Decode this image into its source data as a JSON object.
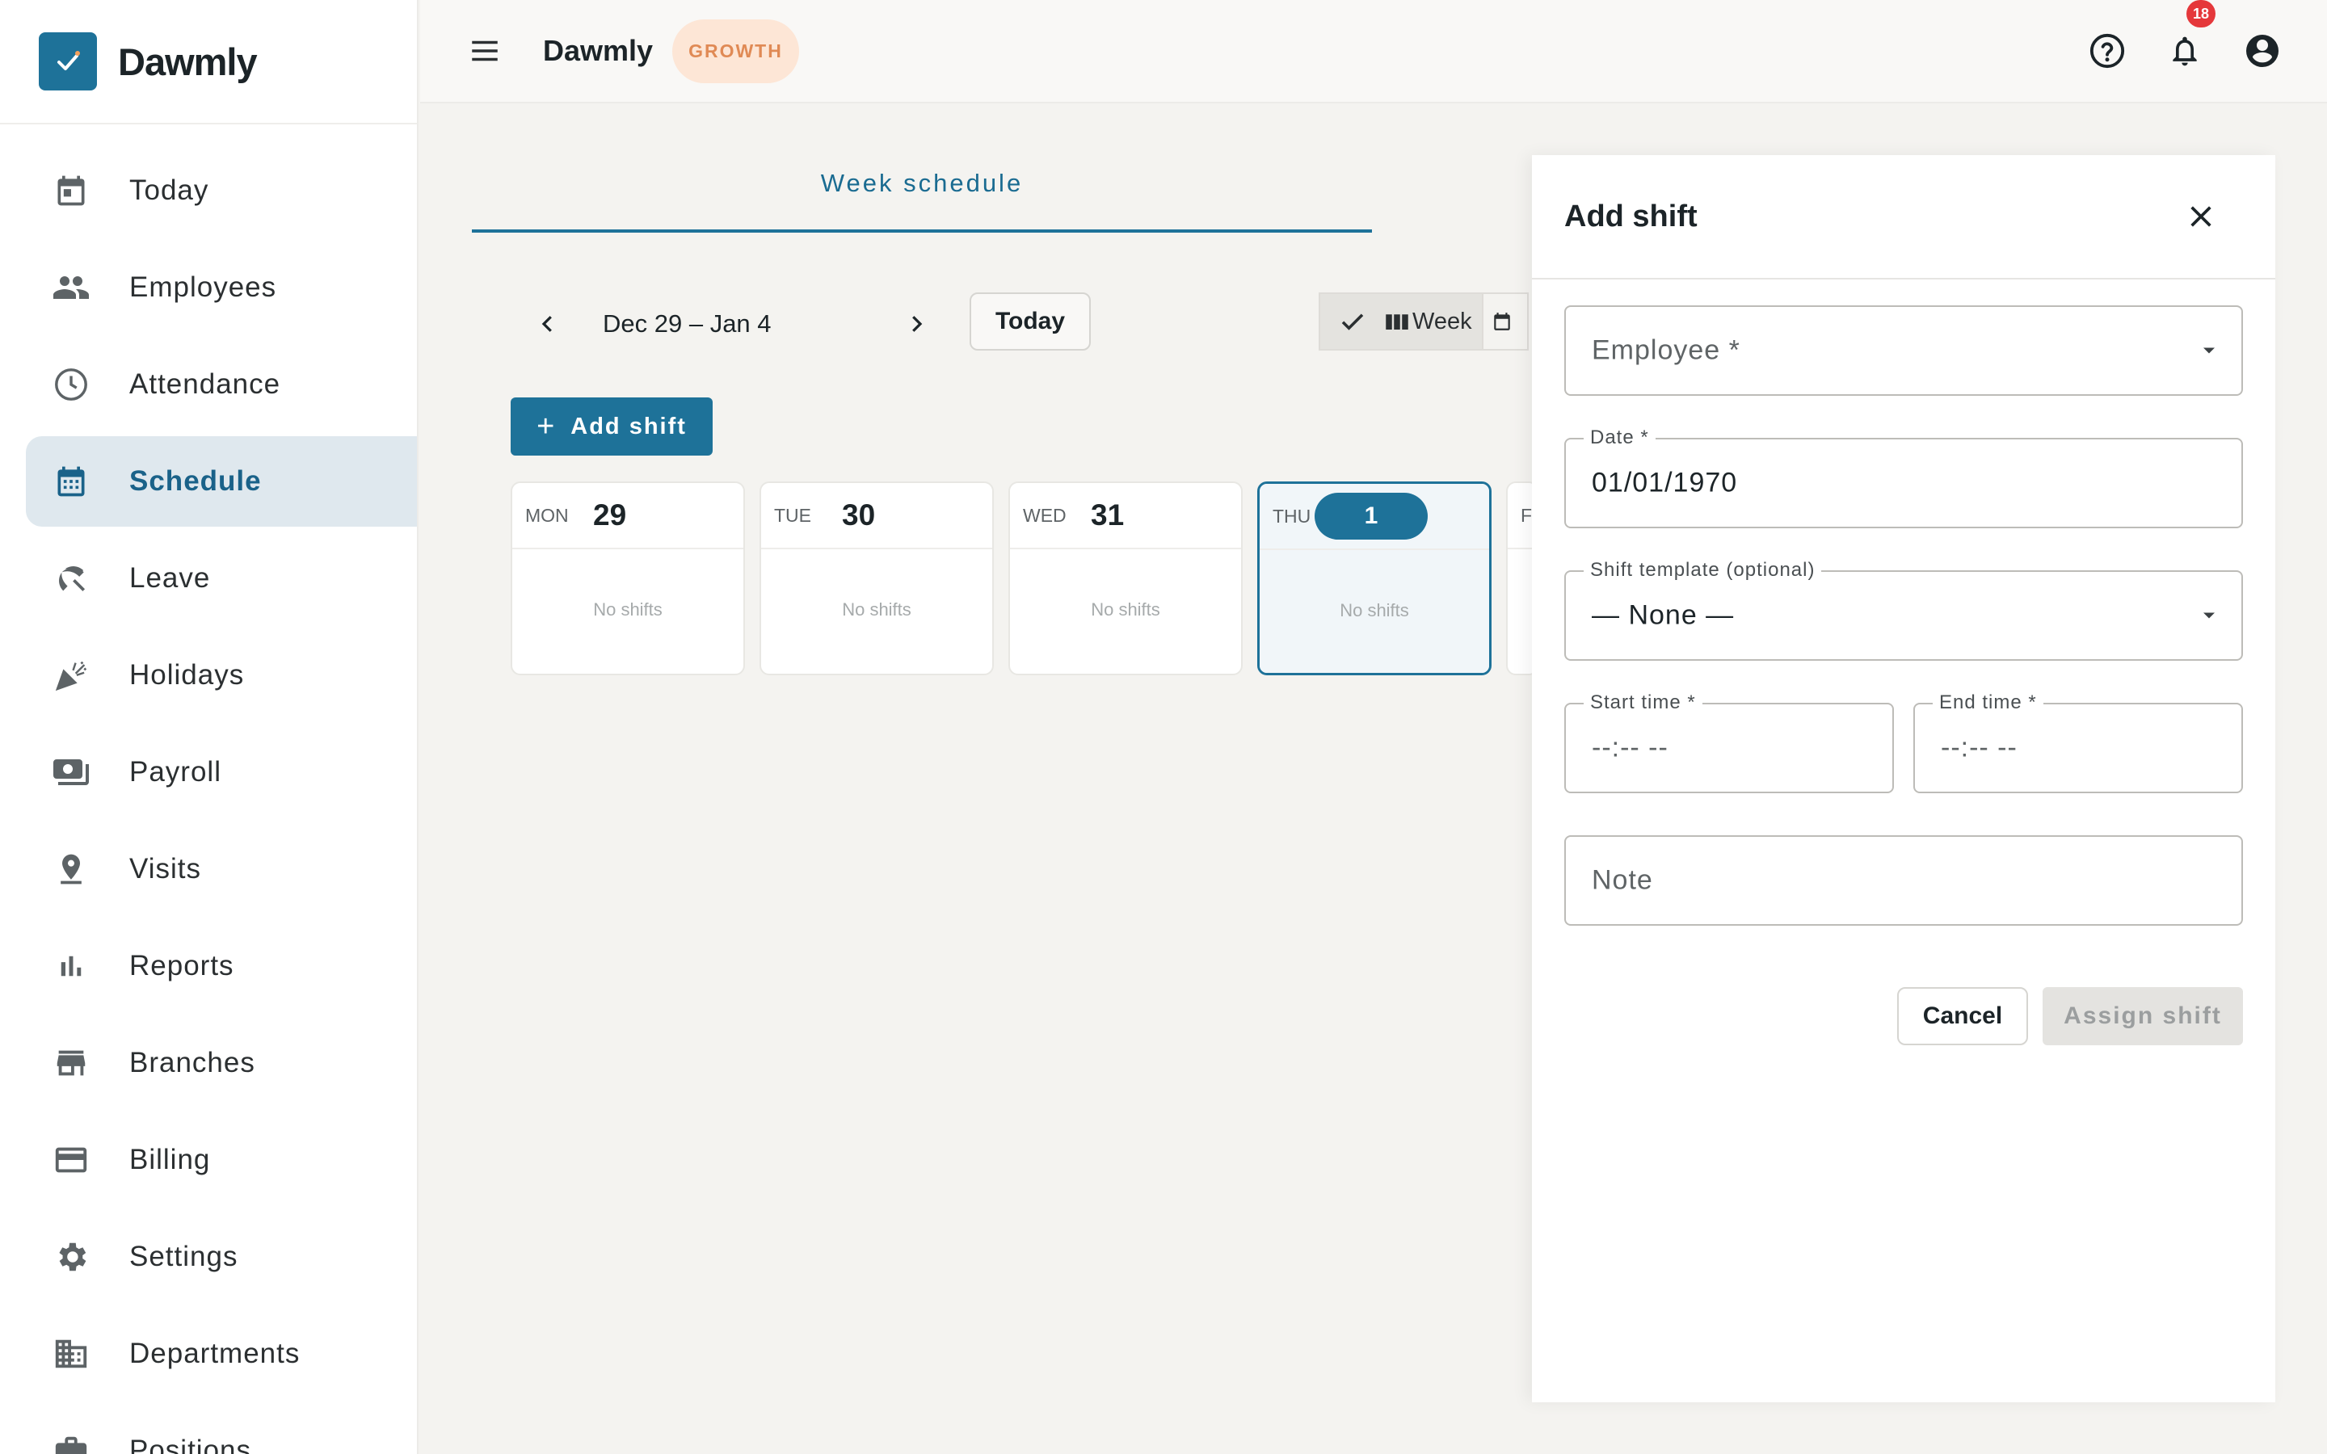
{
  "brand": {
    "name": "Dawmly"
  },
  "sidebar": {
    "items": [
      {
        "label": "Today",
        "icon": "calendar-today-icon"
      },
      {
        "label": "Employees",
        "icon": "people-icon"
      },
      {
        "label": "Attendance",
        "icon": "clock-icon"
      },
      {
        "label": "Schedule",
        "icon": "calendar-month-icon",
        "active": true
      },
      {
        "label": "Leave",
        "icon": "beach-umbrella-icon"
      },
      {
        "label": "Holidays",
        "icon": "celebration-icon"
      },
      {
        "label": "Payroll",
        "icon": "money-icon"
      },
      {
        "label": "Visits",
        "icon": "location-pin-icon"
      },
      {
        "label": "Reports",
        "icon": "bar-chart-icon"
      },
      {
        "label": "Branches",
        "icon": "store-icon"
      },
      {
        "label": "Billing",
        "icon": "credit-card-icon"
      },
      {
        "label": "Settings",
        "icon": "gear-icon"
      },
      {
        "label": "Departments",
        "icon": "building-icon"
      },
      {
        "label": "Positions",
        "icon": "briefcase-icon"
      }
    ]
  },
  "topbar": {
    "app_name": "Dawmly",
    "plan_badge": "GROWTH",
    "notification_count": "18"
  },
  "schedule": {
    "tab_label": "Week schedule",
    "range_label": "Dec 29 – Jan 4",
    "today_label": "Today",
    "view_week_label": "Week",
    "add_shift_label": "Add shift",
    "empty_label": "No shifts",
    "days": [
      {
        "dow": "MON",
        "num": "29"
      },
      {
        "dow": "TUE",
        "num": "30"
      },
      {
        "dow": "WED",
        "num": "31"
      },
      {
        "dow": "THU",
        "num": "1"
      },
      {
        "dow": "FI"
      }
    ]
  },
  "drawer": {
    "title": "Add shift",
    "employee_placeholder": "Employee *",
    "date_label": "Date *",
    "date_value": "01/01/1970",
    "template_label": "Shift template (optional)",
    "template_value": "— None —",
    "start_label": "Start time *",
    "start_value": "--:-- --",
    "end_label": "End time *",
    "end_value": "--:-- --",
    "note_placeholder": "Note",
    "cancel_label": "Cancel",
    "assign_label": "Assign shift"
  },
  "colors": {
    "accent": "#1e7299",
    "sidebar_active_bg": "#dfe8ee",
    "badge_bg": "#fde6d6",
    "badge_text": "#e08a55",
    "notification": "#e5383b"
  }
}
